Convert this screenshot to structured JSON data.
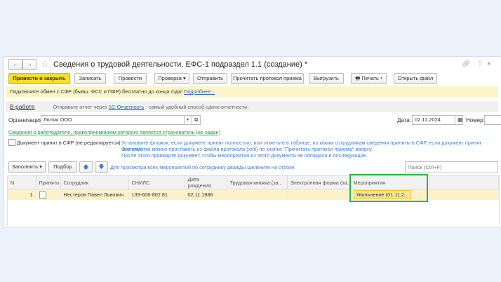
{
  "window": {
    "title": "Сведения о трудовой деятельности, ЕФС-1 подраздел 1.1 (создание) *"
  },
  "toolbar": {
    "post_close": "Провести и закрыть",
    "save": "Записать",
    "post": "Провести",
    "check": "Проверка",
    "send": "Отправить",
    "read_protocol": "Прочитать протокол приема",
    "export": "Выгрузить",
    "print": "Печать",
    "open_file": "Открыть файл"
  },
  "banner": {
    "text": "Подключите обмен с СФР (бывш. ФСС и ПФР) бесплатно до конца года!",
    "link": "Подробнее..."
  },
  "status": {
    "state": "В работе",
    "text_before": "Отправьте отчет через",
    "link": "1С-Отчетность",
    "text_after": "- самый удобный способ сдачи отчетности."
  },
  "form": {
    "org_label": "Организация:",
    "org_value": "Лютик ООО",
    "date_label": "Дата:",
    "date_value": "02.11.2024",
    "number_label": "Номер:",
    "number_value": "",
    "employer_link": "Сведения о работодателе, правопреемником которого является страхователь (не задан)",
    "accepted_label": "Документ принят в СФР (не редактируется)",
    "hint1": "Установите флажок, если документ принят полностью, или отметьте в таблице, по каким сотрудникам сведения приняты в СФР, если документ принят частично.",
    "hint2": "Эти отметки можно проставить из файла протокола (xml) по кнопке \"Прочитать протокол приема\" вверху.",
    "hint3": "После этого проведите документ, чтобы мероприятия из этого документа не попадали в последующие."
  },
  "table_toolbar": {
    "fill": "Заполнить",
    "select": "Подбор",
    "hint": "Для просмотра всех мероприятий по сотруднику дважды щелкните на строке.",
    "search_placeholder": "Поиск (Ctrl+F)"
  },
  "table": {
    "columns": [
      "N",
      "Принято",
      "Сотрудник",
      "СНИЛС",
      "Дата рождения",
      "Трудовая книжка (за...",
      "Электронная форма (за...",
      "Мероприятия"
    ],
    "rows": [
      {
        "n": "1",
        "accepted": false,
        "employee": "Нестеров Павел Львович",
        "snils": "139-606-802 81",
        "birth": "02.11.1986",
        "book": "",
        "eform": "",
        "events": "Увольнение (01.11.2..."
      }
    ]
  },
  "colors": {
    "primary": "#f5df2a",
    "banner": "#fbf5c8",
    "highlight": "#2db34a",
    "link": "#2a63b8"
  }
}
